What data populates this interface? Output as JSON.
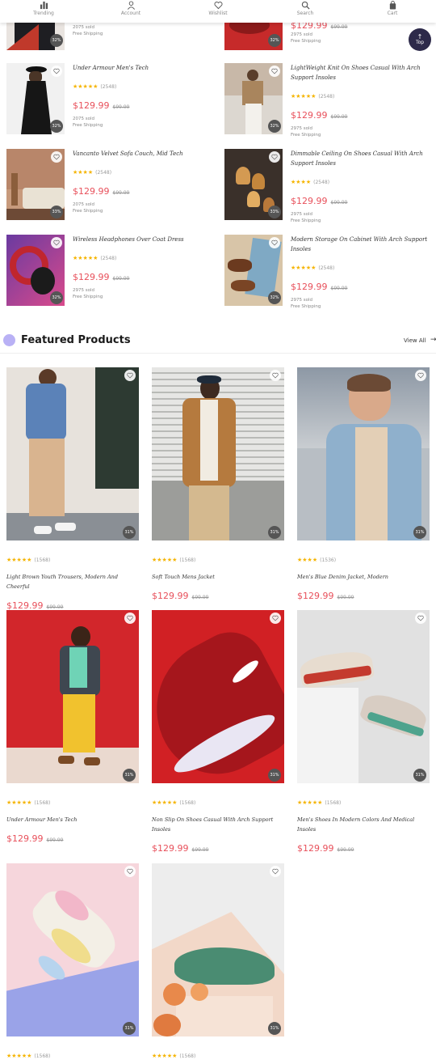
{
  "nav": {
    "items": [
      {
        "label": "Trending",
        "icon": "bar-chart-icon"
      },
      {
        "label": "Account",
        "icon": "user-icon"
      },
      {
        "label": "Wishlist",
        "icon": "heart-icon"
      },
      {
        "label": "Search",
        "icon": "search-icon"
      },
      {
        "label": "Cart",
        "icon": "bag-icon"
      }
    ]
  },
  "top_button": {
    "label": "Top"
  },
  "partial_row": {
    "right": {
      "price": "$129.99",
      "old_price": "$99.99",
      "sold": "2975 sold",
      "shipping": "Free Shipping"
    },
    "left": {
      "sold": "2075 sold",
      "shipping": "Free Shipping"
    },
    "badge_left": "32%",
    "badge_right": "32%"
  },
  "list_products": [
    {
      "name": "Under Armour Men's Tech",
      "rating": "★★★★★",
      "reviews": "(2548)",
      "price": "$129.99",
      "old_price": "$99.99",
      "sold": "2075 sold",
      "shipping": "Free Shipping",
      "badge": "32%"
    },
    {
      "name": "LightWeight Knit On Shoes Casual With Arch Support Insoles",
      "rating": "★★★★★",
      "reviews": "(2548)",
      "price": "$129.99",
      "old_price": "$99.99",
      "sold": "2975 sold",
      "shipping": "Free Shipping",
      "badge": "32%"
    },
    {
      "name": "Vancanto Velvet Sofa Couch, Mid Tech",
      "rating": "★★★★",
      "reviews": "(2548)",
      "price": "$129.99",
      "old_price": "$99.99",
      "sold": "2075 sold",
      "shipping": "Free Shipping",
      "badge": "33%"
    },
    {
      "name": "Dimmable Ceiling On Shoes Casual With Arch Support Insoles",
      "rating": "★★★★",
      "reviews": "(2548)",
      "price": "$129.99",
      "old_price": "$99.99",
      "sold": "2975 sold",
      "shipping": "Free Shipping",
      "badge": "33%"
    },
    {
      "name": "Wireless Headphones Over Coat Dress",
      "rating": "★★★★★",
      "reviews": "(2548)",
      "price": "$129.99",
      "old_price": "$99.99",
      "sold": "2975 sold",
      "shipping": "Free Shipping",
      "badge": "32%"
    },
    {
      "name": "Modern Storage On Cabinet With Arch Support Insoles",
      "rating": "★★★★★",
      "reviews": "(2548)",
      "price": "$129.99",
      "old_price": "$99.99",
      "sold": "2975 sold",
      "shipping": "Free Shipping",
      "badge": "32%"
    }
  ],
  "featured": {
    "title": "Featured Products",
    "view_all": "View All",
    "products": [
      {
        "name": "Light Brown Youth Trousers, Modern And Cheerful",
        "rating": "★★★★★",
        "reviews": "(1568)",
        "price": "$129.99",
        "old_price": "$99.99",
        "badge": "31%"
      },
      {
        "name": "Soft Touch Mens Jacket",
        "rating": "★★★★★",
        "reviews": "(1568)",
        "price": "$129.99",
        "old_price": "$99.99",
        "badge": "31%"
      },
      {
        "name": "Men's Blue Denim Jacket, Modern",
        "rating": "★★★★",
        "reviews": "(1536)",
        "price": "$129.99",
        "old_price": "$99.99",
        "badge": "31%"
      },
      {
        "name": "Under Armour Men's Tech",
        "rating": "★★★★★",
        "reviews": "(1568)",
        "price": "$129.99",
        "old_price": "$99.99",
        "badge": "31%"
      },
      {
        "name": "Non Slip On Shoes Casual With Arch Support Insoles",
        "rating": "★★★★★",
        "reviews": "(1568)",
        "price": "$129.99",
        "old_price": "$99.99",
        "badge": "31%"
      },
      {
        "name": "Men's Shoes In Modern Colors And Medical Insoles",
        "rating": "★★★★★",
        "reviews": "(1568)",
        "price": "$129.99",
        "old_price": "$99.99",
        "badge": "31%"
      },
      {
        "name": "",
        "rating": "★★★★★",
        "reviews": "(1568)",
        "price": "",
        "old_price": "",
        "badge": "31%"
      },
      {
        "name": "",
        "rating": "★★★★★",
        "reviews": "(1568)",
        "price": "",
        "old_price": "",
        "badge": "31%"
      }
    ]
  },
  "colors": {
    "accent": "#e8505b",
    "star": "#f5b400",
    "section_dot": "#b9b1f5",
    "top_button": "#2d2a4a"
  }
}
